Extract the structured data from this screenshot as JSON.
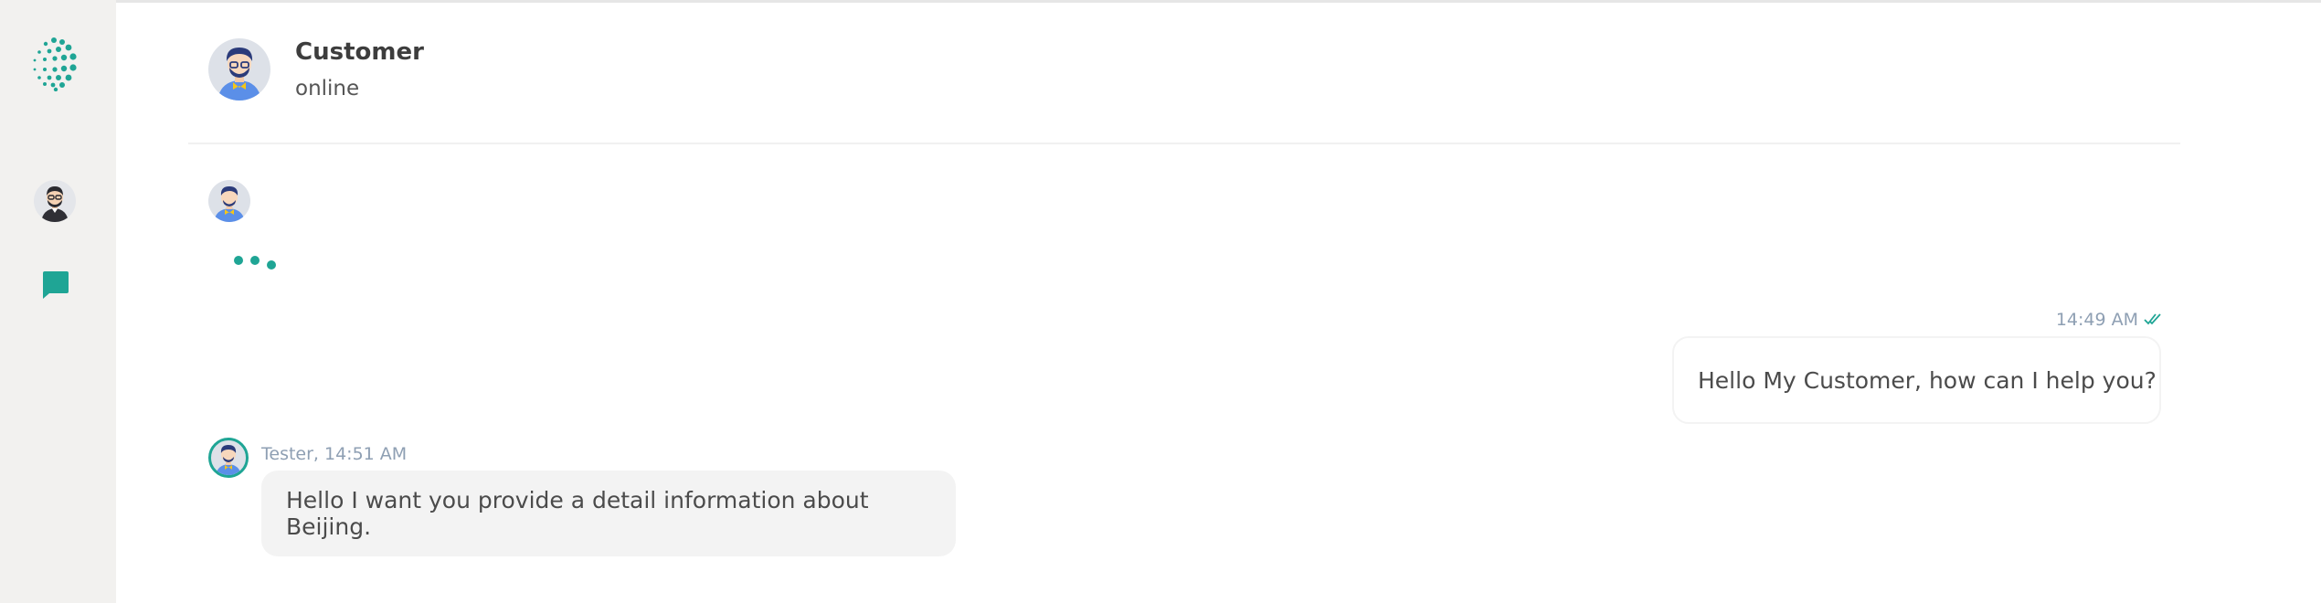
{
  "app": {
    "accent_color": "#1fa595",
    "sidebar_color": "#f2f1ef"
  },
  "sidebar": {
    "logo_icon": "dots-logo-icon",
    "items": [
      {
        "icon": "user-avatar-icon"
      },
      {
        "icon": "chat-bubble-icon"
      }
    ]
  },
  "header": {
    "name": "Customer",
    "status": "online",
    "avatar_icon": "customer-avatar-icon"
  },
  "messages": [
    {
      "direction": "incoming",
      "typing": true,
      "avatar_icon": "customer-avatar-icon"
    },
    {
      "direction": "outgoing",
      "time": "14:49 AM",
      "status_icon": "double-check-icon",
      "text": "Hello My Customer, how can I help you?"
    },
    {
      "direction": "incoming",
      "meta": "Tester, 14:51 AM",
      "text": "Hello I want you provide a detail information about Beijing.",
      "avatar_icon": "tester-avatar-icon"
    }
  ]
}
